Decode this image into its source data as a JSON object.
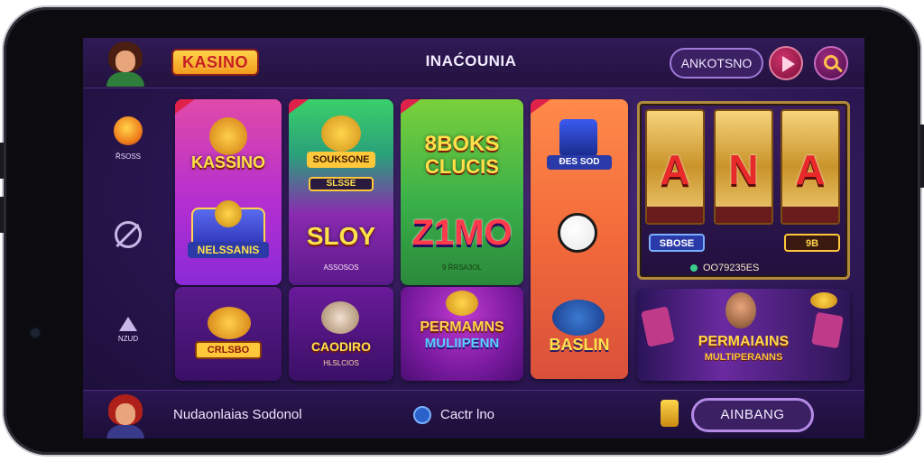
{
  "header": {
    "logo_text": "KASINO",
    "title": "INAĆOUNIA",
    "account_button": "ANKOTSNO",
    "play_icon": "play-icon",
    "search_icon": "search-icon"
  },
  "sidebar": {
    "items": [
      {
        "icon": "flame-icon",
        "label": "ŘSOSS"
      },
      {
        "icon": "shield-icon",
        "label": ""
      },
      {
        "icon": "triangle-icon",
        "label": "NZUD"
      }
    ]
  },
  "cards": {
    "card1_title": "KASSINO",
    "card1_badge": "NELSSANIS",
    "card2_label": "SOUKSONE",
    "card2_pill": "SLSSE",
    "card2_title": "SLOY",
    "card2_sub": "ASSOSOS",
    "card3_title_a": "8BOKS",
    "card3_title_b": "CLUCIS",
    "card3_number": "Z1MO",
    "card3_sub": "9 ŘRSA3OL",
    "card4_label": "ĐES SOD",
    "card5_pill": "CRLSBO",
    "card6_title": "CAODIRO",
    "card6_sub": "HLSLCIOS",
    "card7_title": "PERMAMNS",
    "card7_sub": "MULIIPENN",
    "card8_title": "BASLIN"
  },
  "slot": {
    "letters": [
      "A",
      "N",
      "A"
    ],
    "pill_left": "SBOSE",
    "pill_right": "9B",
    "footer": "OO79235ES"
  },
  "promo": {
    "title": "PERMAIAINS",
    "subtitle": "MULTIPERANNS"
  },
  "footer": {
    "left_text": "Nudaonlaias Sodonol",
    "center_text": "Cactr lno",
    "cta_label": "AINBANG"
  },
  "colors": {
    "accent_purple": "#3b2064",
    "gold": "#ffe14a",
    "accent_pink": "#d0336b"
  }
}
